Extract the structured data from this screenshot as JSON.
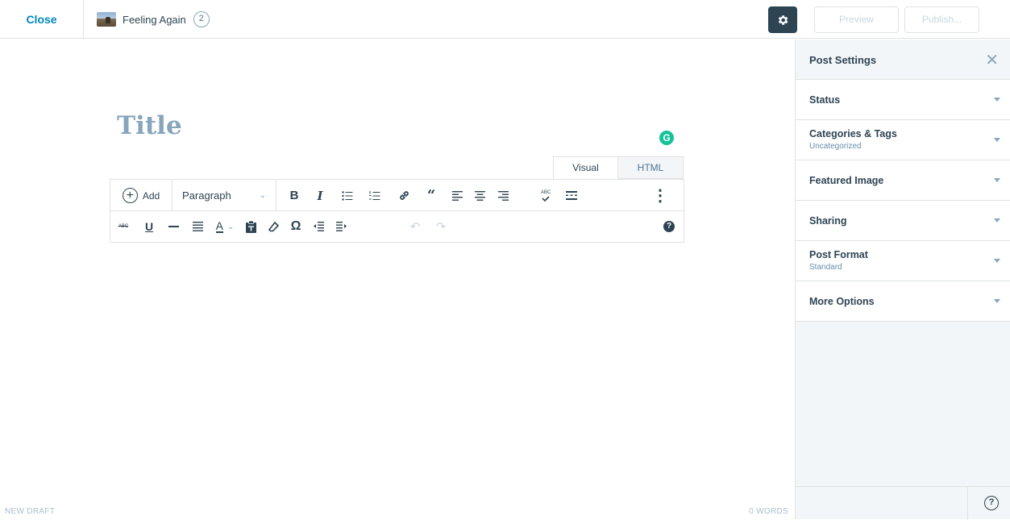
{
  "topbar": {
    "close_label": "Close",
    "site_name": "Feeling Again",
    "revisions_count": "2",
    "preview_label": "Preview",
    "publish_label": "Publish..."
  },
  "editor": {
    "title_placeholder": "Title",
    "grammarly_badge": "G",
    "tabs": [
      {
        "label": "Visual",
        "active": true
      },
      {
        "label": "HTML",
        "active": false
      }
    ],
    "toolbar_row1": {
      "add_label": "Add",
      "block_format": "Paragraph",
      "icons": [
        "bold-icon",
        "italic-icon",
        "bullet-list-icon",
        "numbered-list-icon",
        "link-icon",
        "blockquote-icon",
        "align-left-icon",
        "align-center-icon",
        "align-right-icon",
        "spellcheck-icon",
        "read-more-icon",
        "more-options-icon"
      ],
      "bold_glyph": "B",
      "italic_glyph": "I",
      "spellcheck_glyph": "ABC"
    },
    "toolbar_row2": {
      "icons": [
        "strikethrough-icon",
        "underline-icon",
        "horizontal-rule-icon",
        "justify-icon",
        "text-color-icon",
        "paste-text-icon",
        "clear-formatting-icon",
        "special-character-icon",
        "outdent-icon",
        "indent-icon",
        "undo-icon",
        "redo-icon",
        "keyboard-shortcuts-icon"
      ],
      "strike_glyph": "ABC",
      "underline_glyph": "U",
      "text_color_glyph": "A",
      "omega_glyph": "Ω",
      "help_glyph": "?"
    }
  },
  "statusbar": {
    "draft_label": "NEW DRAFT",
    "word_count": "0 WORDS"
  },
  "sidebar": {
    "title": "Post Settings",
    "sections": [
      {
        "label": "Status",
        "sub": ""
      },
      {
        "label": "Categories & Tags",
        "sub": "Uncategorized"
      },
      {
        "label": "Featured Image",
        "sub": ""
      },
      {
        "label": "Sharing",
        "sub": ""
      },
      {
        "label": "Post Format",
        "sub": "Standard"
      },
      {
        "label": "More Options",
        "sub": ""
      }
    ],
    "help_glyph": "?"
  },
  "colors": {
    "accent": "#0087be",
    "primary_dark": "#2e4453",
    "muted": "#87a6bc",
    "grammarly": "#15c39a"
  }
}
